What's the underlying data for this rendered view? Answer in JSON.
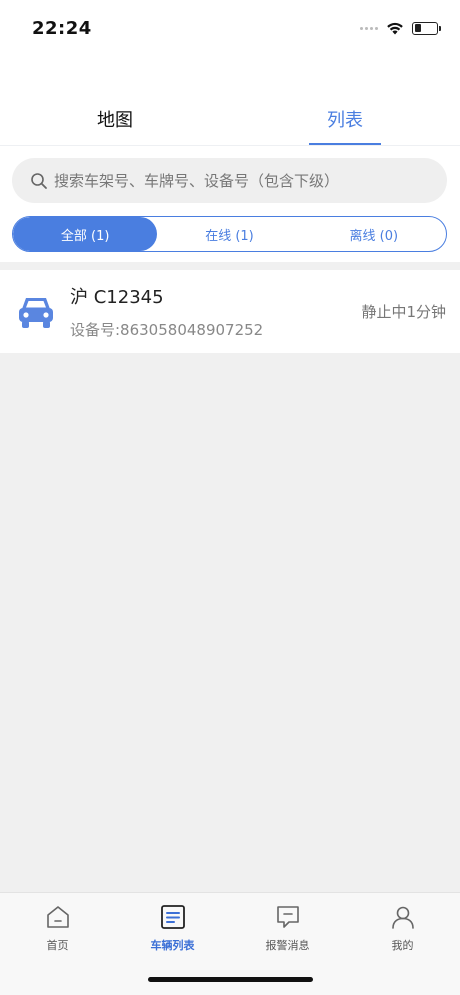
{
  "status_bar": {
    "time": "22:24"
  },
  "top_tabs": [
    {
      "label": "地图",
      "active": false
    },
    {
      "label": "列表",
      "active": true
    }
  ],
  "search": {
    "placeholder": "搜索车架号、车牌号、设备号（包含下级）"
  },
  "filters": [
    {
      "label": "全部 (1)",
      "active": true
    },
    {
      "label": "在线 (1)",
      "active": false
    },
    {
      "label": "离线 (0)",
      "active": false
    }
  ],
  "vehicles": [
    {
      "plate": "沪 C12345",
      "device": "设备号:863058048907252",
      "status": "静止中1分钟",
      "icon": "car-icon"
    }
  ],
  "bottom_nav": [
    {
      "label": "首页",
      "icon": "home-icon",
      "active": false
    },
    {
      "label": "车辆列表",
      "icon": "list-icon",
      "active": true
    },
    {
      "label": "报警消息",
      "icon": "message-icon",
      "active": false
    },
    {
      "label": "我的",
      "icon": "user-icon",
      "active": false
    }
  ],
  "colors": {
    "accent": "#4a7ee0",
    "background": "#f0f0f0"
  }
}
